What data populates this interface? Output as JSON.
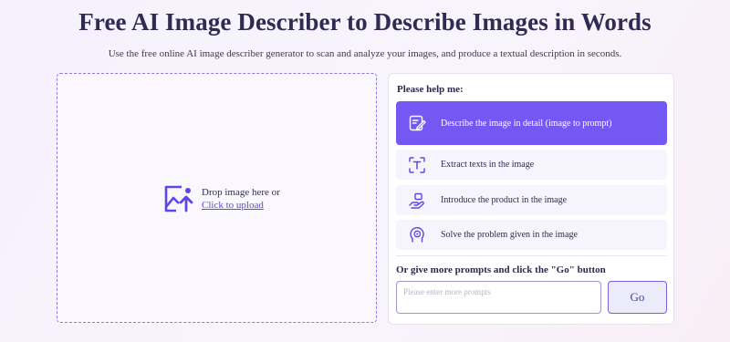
{
  "header": {
    "title": "Free AI Image Describer to Describe Images in Words",
    "subtitle": "Use the free online AI image describer generator to scan and analyze your images, and produce a textual description in seconds."
  },
  "upload": {
    "drop_text": "Drop image here or",
    "click_text": "Click to upload",
    "icon": "image-upload-icon"
  },
  "panel": {
    "heading": "Please help me:",
    "options": [
      {
        "label": "Describe the image in detail (image to prompt)",
        "icon": "edit-document-icon",
        "active": true
      },
      {
        "label": "Extract texts in the image",
        "icon": "text-scan-icon",
        "active": false
      },
      {
        "label": "Introduce the product in the image",
        "icon": "product-hand-icon",
        "active": false
      },
      {
        "label": "Solve the problem given in the image",
        "icon": "brain-icon",
        "active": false
      }
    ],
    "prompt_heading": "Or give more prompts and click the \"Go\" button",
    "prompt_placeholder": "Please enter more prompts",
    "go_label": "Go"
  },
  "colors": {
    "accent": "#7358f3",
    "title": "#2f2c52",
    "link": "#5a47e6",
    "option_bg": "#f6f4fc"
  }
}
